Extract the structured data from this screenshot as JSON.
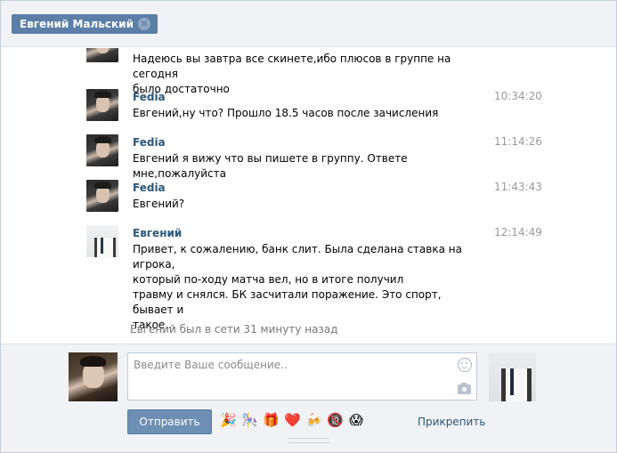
{
  "tab": {
    "title": "Евгений Мальский"
  },
  "messages": [
    {
      "author": "",
      "time": "",
      "avatar": "fedia",
      "lines": [
        "Надеюсь вы завтра все скинете,ибо плюсов в группе на сегодня",
        "было достаточно"
      ]
    },
    {
      "author": "Fedia",
      "time": "10:34:20",
      "avatar": "fedia",
      "lines": [
        "Евгений,ну что? Прошло 18.5 часов после зачисления"
      ]
    },
    {
      "author": "Fedia",
      "time": "11:14:26",
      "avatar": "fedia",
      "lines": [
        "Евгений я вижу что вы пишете в группу. Ответе мне,пожалуйста"
      ]
    },
    {
      "author": "Fedia",
      "time": "11:43:43",
      "avatar": "fedia",
      "lines": [
        "Евгений?"
      ]
    },
    {
      "author": "Евгений",
      "time": "12:14:49",
      "avatar": "evgeniy",
      "lines": [
        "Привет, к сожалению, банк слит. Была сделана ставка на игрока,",
        "который по-ходу матча вел, но в итоге получил",
        "травму и снялся. БК засчитали поражение. Это спорт, бывает и",
        "такое..."
      ]
    }
  ],
  "status": "Евгений был в сети 31 минуту назад",
  "composer": {
    "placeholder": "Введите Ваше сообщение..",
    "send_label": "Отправить",
    "attach_label": "Прикрепить",
    "emojis": [
      {
        "name": "party-popper-icon",
        "glyph": "🎉"
      },
      {
        "name": "carousel-icon",
        "glyph": "🎠"
      },
      {
        "name": "gift-icon",
        "glyph": "🎁"
      },
      {
        "name": "heart-icon",
        "glyph": "❤️"
      },
      {
        "name": "beer-icon",
        "glyph": "🍻"
      },
      {
        "name": "underage-icon",
        "glyph": "🔞"
      },
      {
        "name": "scream-face-icon",
        "glyph": "😱"
      }
    ]
  }
}
